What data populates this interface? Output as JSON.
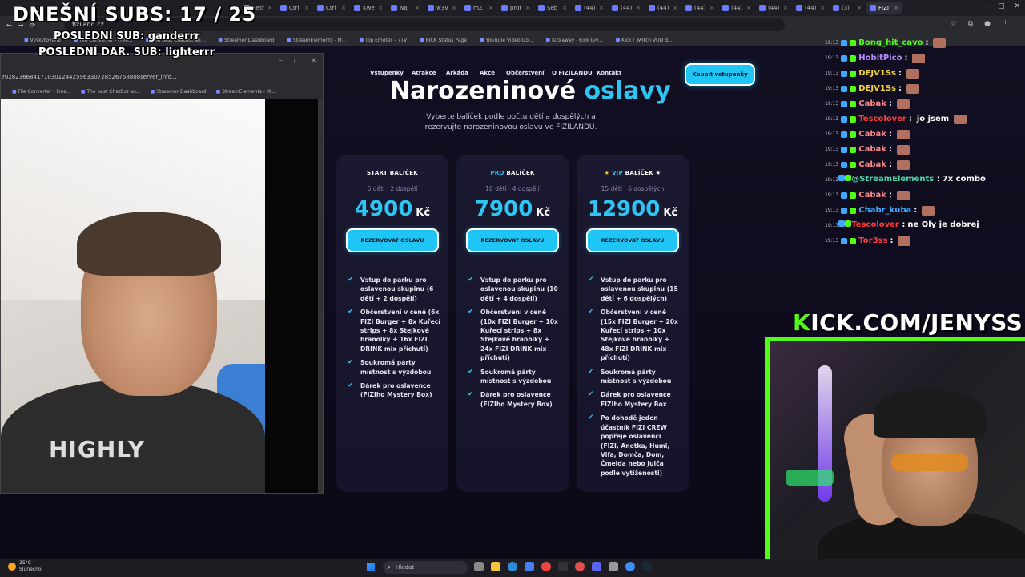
{
  "overlay": {
    "subs_count": "DNEŠNÍ SUBS: 17 / 25",
    "last_sub": "POSLEDNÍ SUB: ganderrr",
    "last_dar": "POSLEDNÍ DAR. SUB: lighterrr"
  },
  "browser": {
    "tabs": [
      "Betf",
      "Ctrl",
      "Ctrl",
      "Kwe",
      "Naj",
      "w3V",
      "mZ",
      "prof",
      "Seb",
      "(44)",
      "(44)",
      "(44)",
      "(44)",
      "(44)",
      "(44)",
      "(44)",
      "(3)",
      "FIZI"
    ],
    "url": "fiziland.cz",
    "bookmarks": [
      "Vyskytované",
      "File Converter - Free...",
      "The best ChatBot an...",
      "Streamer Dashboard",
      "StreamElements - M...",
      "Top Emotes - 7TV",
      "KICK Status Page",
      "YouTube Video Do...",
      "Kickaway - Kick Giv...",
      "Kick / Twitch VOD d..."
    ]
  },
  "mini_window": {
    "url": "r02823668417103012442596330728526758808server_info...",
    "bookmarks": [
      "File Converter - Free...",
      "The best ChatBot an...",
      "Streamer Dashboard",
      "StreamElements - M..."
    ],
    "shirt_text": "HIGHLY"
  },
  "site": {
    "nav": [
      "Vstupenky",
      "Atrakce",
      "Arkáda",
      "Akce",
      "Občerstvení",
      "O FIZILANDU",
      "Kontakt"
    ],
    "cta": "Koupit vstupenky",
    "title_main": "Narozeninové",
    "title_accent": "oslavy",
    "subtitle": "Vyberte balíček podle počtu dětí a dospělých a rezervujte narozeninovou oslavu ve FIZILANDU.",
    "cards": [
      {
        "title_prefix": "",
        "title_hl": "",
        "title": "START BALÍČEK",
        "meta": "6 dětí · 2 dospělí",
        "price": "4900",
        "currency": "Kč",
        "button": "REZERVOVAT OSLAVU",
        "features": [
          "Vstup do parku pro oslavenou skupinu (6 dětí + 2 dospělí)",
          "Občerstvení v ceně (6x FIZI Burger + 8x Kuřecí strips + 8x Stejkové hranolky + 16x FIZI DRINK mix příchutí)",
          "Soukromá párty místnost s výzdobou",
          "Dárek pro oslavence (FIZIho Mystery Box)"
        ]
      },
      {
        "title_prefix": "",
        "title_hl": "PRO",
        "title": " BALÍČEK",
        "meta": "10 dětí · 4 dospělí",
        "price": "7900",
        "currency": "Kč",
        "button": "REZERVOVAT OSLAVU",
        "features": [
          "Vstup do parku pro oslavenou skupinu (10 dětí + 4 dospělí)",
          "Občerstvení v ceně (10x FIZI Burger + 10x Kuřecí strips + 8x Stejkové hranolky + 24x FIZI DRINK mix příchutí)",
          "Soukromá párty místnost s výzdobou",
          "Dárek pro oslavence (FIZIho Mystery Box)"
        ]
      },
      {
        "title_prefix": "★ ",
        "title_hl": "VIP",
        "title": " BALÍČEK ★",
        "meta": "15 dětí · 6 dospělých",
        "price": "12900",
        "currency": "Kč",
        "button": "REZERVOVAT OSLAVU",
        "features": [
          "Vstup do parku pro oslavenou skupinu (15 dětí + 6 dospělých)",
          "Občerstvení v ceně (15x FIZI Burger + 20x Kuřecí strips + 10x Stejkové hranolky + 48x FIZI DRINK mix příchutí)",
          "Soukromá párty místnost s výzdobou",
          "Dárek pro oslavence FIZIho Mystery Box",
          "Po dohodě jeden účastník FIZI CREW popřeje oslavenci (FIZI, Anetka, Humi, Vifa, Domča, Dom, Čmelda nebo Julča podle vytíženosti)"
        ]
      }
    ]
  },
  "chat": [
    {
      "time": "19:13",
      "user": "Bong_hit_cavo",
      "color": "#53fc18",
      "msg": ""
    },
    {
      "time": "19:13",
      "user": "HobitPico",
      "color": "#b68cff",
      "msg": ""
    },
    {
      "time": "19:13",
      "user": "DEJV1Ss",
      "color": "#f3d23a",
      "msg": ""
    },
    {
      "time": "19:13",
      "user": "DEJV1Ss",
      "color": "#f3d23a",
      "msg": ""
    },
    {
      "time": "19:13",
      "user": "Cabak",
      "color": "#ff8a8a",
      "msg": ""
    },
    {
      "time": "19:13",
      "user": "Tescolover",
      "color": "#ff3b3b",
      "msg": "jo jsem"
    },
    {
      "time": "19:13",
      "user": "Cabak",
      "color": "#ff8a8a",
      "msg": ""
    },
    {
      "time": "19:13",
      "user": "Cabak",
      "color": "#ff8a8a",
      "msg": ""
    },
    {
      "time": "19:13",
      "user": "Cabak",
      "color": "#ff8a8a",
      "msg": ""
    },
    {
      "time": "19:13",
      "user": "@StreamElements",
      "color": "#4fd6a8",
      "msg": "7x combo",
      "multi": true
    },
    {
      "time": "19:13",
      "user": "Cabak",
      "color": "#ff8a8a",
      "msg": ""
    },
    {
      "time": "19:13",
      "user": "Chabr_kuba",
      "color": "#3fa9ff",
      "msg": ""
    },
    {
      "time": "19:13",
      "user": "Tescolover",
      "color": "#ff3b3b",
      "msg": "ne Oly je dobrej",
      "multi": true
    },
    {
      "time": "19:13",
      "user": "Tor3ss",
      "color": "#ff3b3b",
      "msg": ""
    }
  ],
  "stream": {
    "kick_prefix": "K",
    "kick_rest": "ICK.COM/JENYSS"
  },
  "taskbar": {
    "temp": "25°C",
    "weather": "Slunečno",
    "search": "Hledat"
  },
  "colors": {
    "accent": "#2ec5f3",
    "kick_green": "#53fc18",
    "page_bg": "#120f22"
  }
}
